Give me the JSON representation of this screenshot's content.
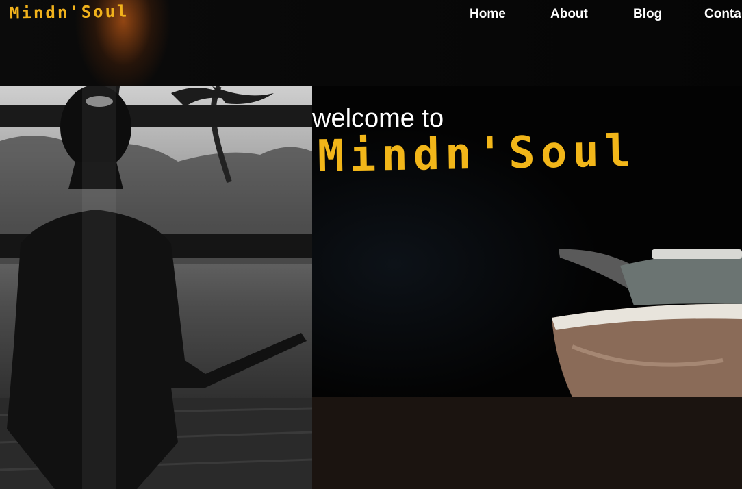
{
  "header": {
    "brand": "Mindn'Soul",
    "nav": [
      {
        "label": "Home"
      },
      {
        "label": "About"
      },
      {
        "label": "Blog"
      },
      {
        "label": "Conta"
      }
    ]
  },
  "hero": {
    "welcome": "welcome to",
    "brand": "Mindn'Soul"
  },
  "colors": {
    "brand_yellow": "#f2b619",
    "background": "#050505",
    "footer_band": "#1b1410"
  }
}
